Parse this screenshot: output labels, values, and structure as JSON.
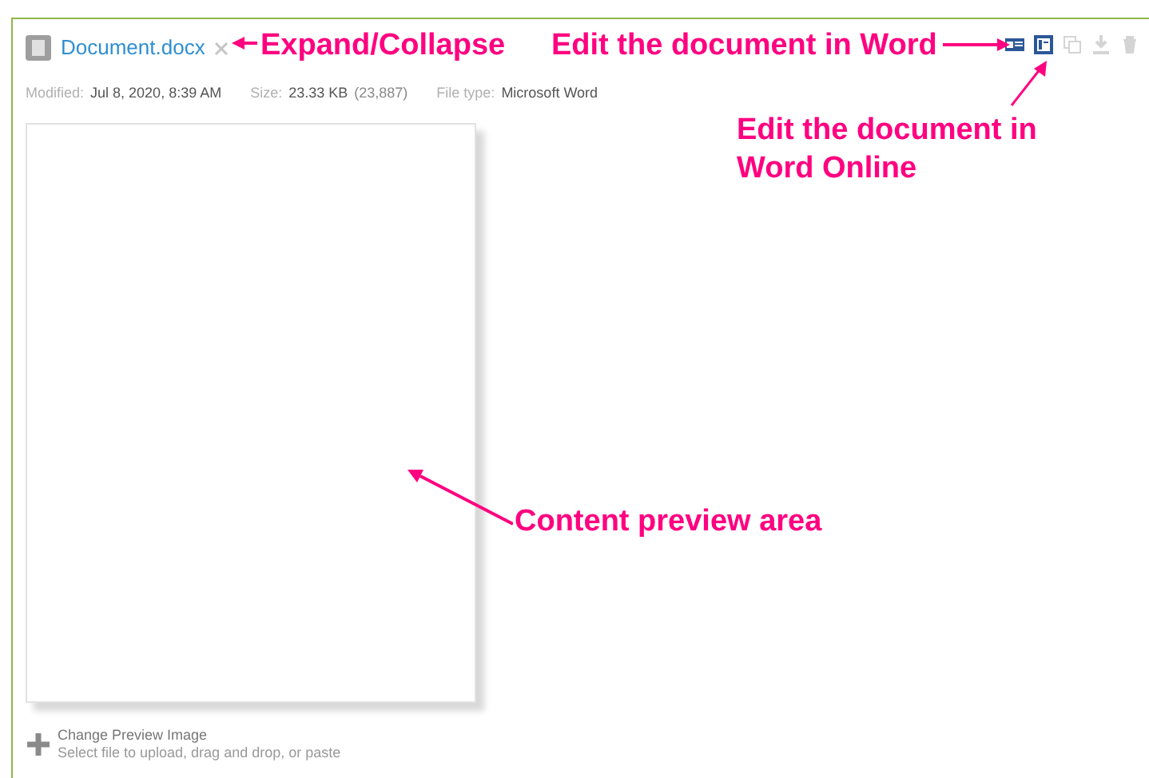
{
  "file": {
    "name": "Document.docx"
  },
  "meta": [
    {
      "label": "Modified:",
      "value": "Jul 8, 2020, 8:39 AM"
    },
    {
      "label": "Size:",
      "value": "23.33 KB",
      "extra": "(23,887)"
    },
    {
      "label": "File type:",
      "value": "Microsoft Word"
    }
  ],
  "actions": [
    {
      "kind": "word",
      "disabled": false
    },
    {
      "kind": "word-online",
      "disabled": false
    },
    {
      "kind": "copy",
      "disabled": true
    },
    {
      "kind": "download",
      "disabled": true
    },
    {
      "kind": "delete",
      "disabled": true
    }
  ],
  "change_preview": {
    "title": "Change Preview Image",
    "hint": "Select file to upload, drag and drop, or paste"
  },
  "annotations": [
    {
      "kind": "expand",
      "text": "Expand/Collapse"
    },
    {
      "kind": "word",
      "text": "Edit the document in Word"
    },
    {
      "kind": "online",
      "text": "Edit the document in Word Online"
    },
    {
      "kind": "preview",
      "text": "Content preview area"
    }
  ]
}
